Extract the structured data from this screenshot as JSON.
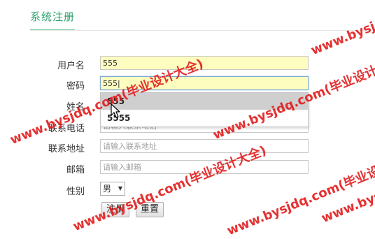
{
  "header": {
    "title": "系统注册"
  },
  "form": {
    "username": {
      "label": "用户名",
      "value": "555"
    },
    "password": {
      "label": "密码",
      "value": "555|"
    },
    "name": {
      "label": "姓名"
    },
    "phone": {
      "label": "联系电话",
      "placeholder": "请输入联系电话"
    },
    "address": {
      "label": "联系地址",
      "placeholder": "请输入联系地址"
    },
    "email": {
      "label": "邮箱",
      "placeholder": "请输入邮箱"
    },
    "gender": {
      "label": "性别",
      "selected": "男"
    },
    "buttons": {
      "submit": "注册",
      "reset": "重置"
    }
  },
  "autocomplete": {
    "items": [
      "555",
      "5555"
    ]
  },
  "watermark": {
    "text": "www.bysjdq.com(毕业设计大全)",
    "color": "#e31b1b"
  }
}
